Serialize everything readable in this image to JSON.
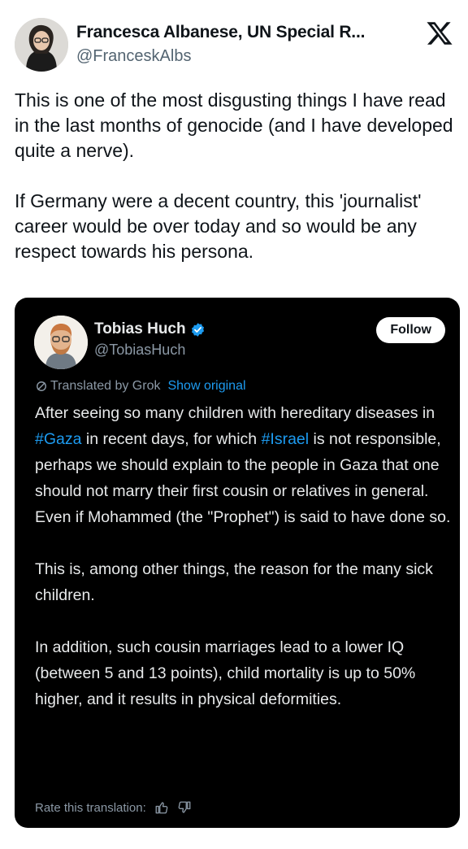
{
  "post": {
    "author_name": "Francesca Albanese, UN Special R...",
    "author_handle": "@FranceskAlbs",
    "paragraphs": [
      "This is one of the most disgusting things I have read in the last months of genocide (and I have developed quite a nerve).",
      "If Germany were a decent country, this 'journalist' career would be over today and so would be any respect towards his persona."
    ]
  },
  "quote": {
    "author_name": "Tobias Huch",
    "author_handle": "@TobiasHuch",
    "follow_label": "Follow",
    "translated_label": "Translated by Grok",
    "show_original_label": "Show original",
    "p1": {
      "a": "After seeing so many children with hereditary diseases in ",
      "tag1": "#Gaza",
      "b": " in recent days, for which ",
      "tag2": "#Israel",
      "c": " is not responsible, perhaps we should explain to the people in Gaza that one should not marry their first cousin or relatives in general. Even if Mohammed (the \"Prophet\") is said to have done so."
    },
    "p2": "This is, among other things, the reason for the many sick children.",
    "p3": "In addition, such cousin marriages lead to a lower IQ (between 5 and 13 points), child mortality is up to 50% higher, and it results in physical deformities.",
    "rate_label": "Rate this translation:"
  },
  "colors": {
    "link": "#1d9bf0",
    "verified_badge": "#1d9bf0",
    "card_background": "#000000",
    "secondary_text": "#8b98a5"
  },
  "icons": [
    "x-logo-icon",
    "verified-badge-icon",
    "grok-icon",
    "thumbs-up-icon",
    "thumbs-down-icon"
  ]
}
